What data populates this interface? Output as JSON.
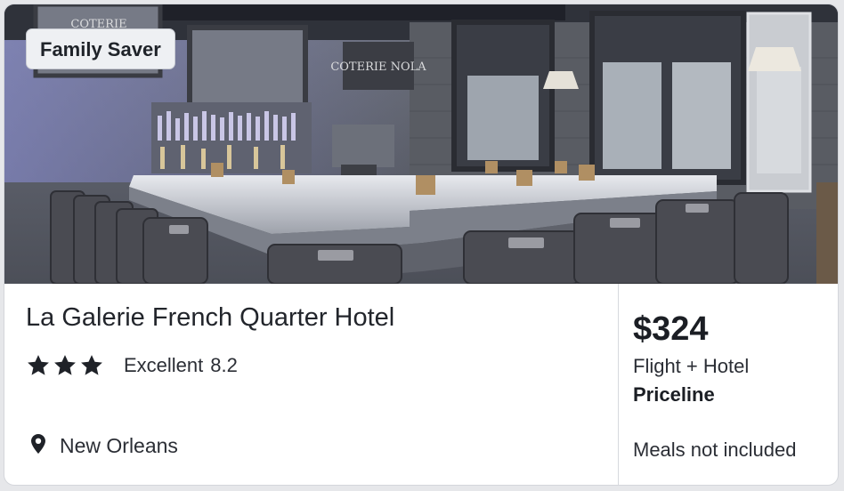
{
  "badge": {
    "label": "Family Saver"
  },
  "photo": {
    "signs": [
      "COTERIE",
      "COTERIE NOLA"
    ]
  },
  "hotel": {
    "name": "La Galerie French Quarter Hotel",
    "stars": 3,
    "rating_label": "Excellent",
    "rating_score": "8.2",
    "location": "New Orleans"
  },
  "deal": {
    "price": "$324",
    "package": "Flight + Hotel",
    "provider": "Priceline",
    "meals": "Meals not included"
  },
  "icons": {
    "star": "star-icon",
    "location": "map-pin-icon"
  },
  "colors": {
    "text": "#22252b",
    "badge_bg": "#eef0f3",
    "divider": "#d7d9de"
  }
}
